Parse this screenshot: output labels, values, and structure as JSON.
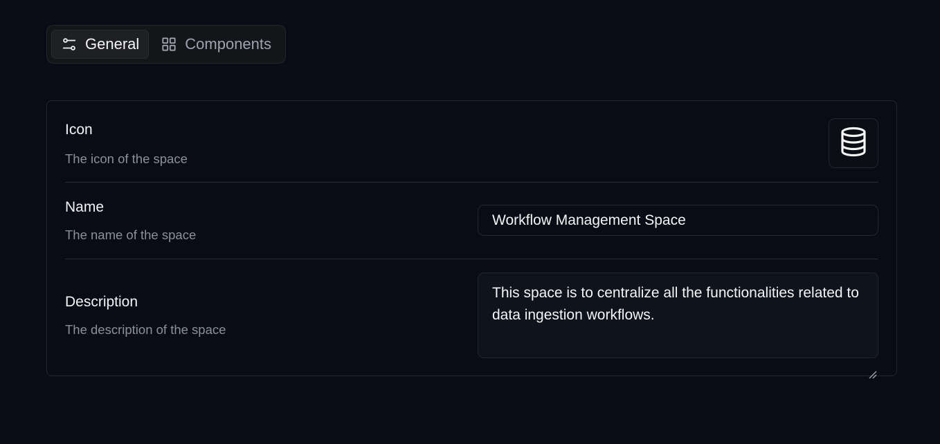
{
  "tabs": [
    {
      "label": "General",
      "icon": "sliders-icon",
      "active": true
    },
    {
      "label": "Components",
      "icon": "grid-icon",
      "active": false
    }
  ],
  "settings": {
    "icon": {
      "label": "Icon",
      "help": "The icon of the space",
      "value": "database-icon"
    },
    "name": {
      "label": "Name",
      "help": "The name of the space",
      "value": "Workflow Management Space"
    },
    "description": {
      "label": "Description",
      "help": "The description of the space",
      "value": "This space is to centralize all the functionalities related to data ingestion workflows."
    }
  },
  "colors": {
    "background": "#090c14",
    "border": "#24262d",
    "text_primary": "#f3f4f6",
    "text_muted": "#8b919b"
  }
}
